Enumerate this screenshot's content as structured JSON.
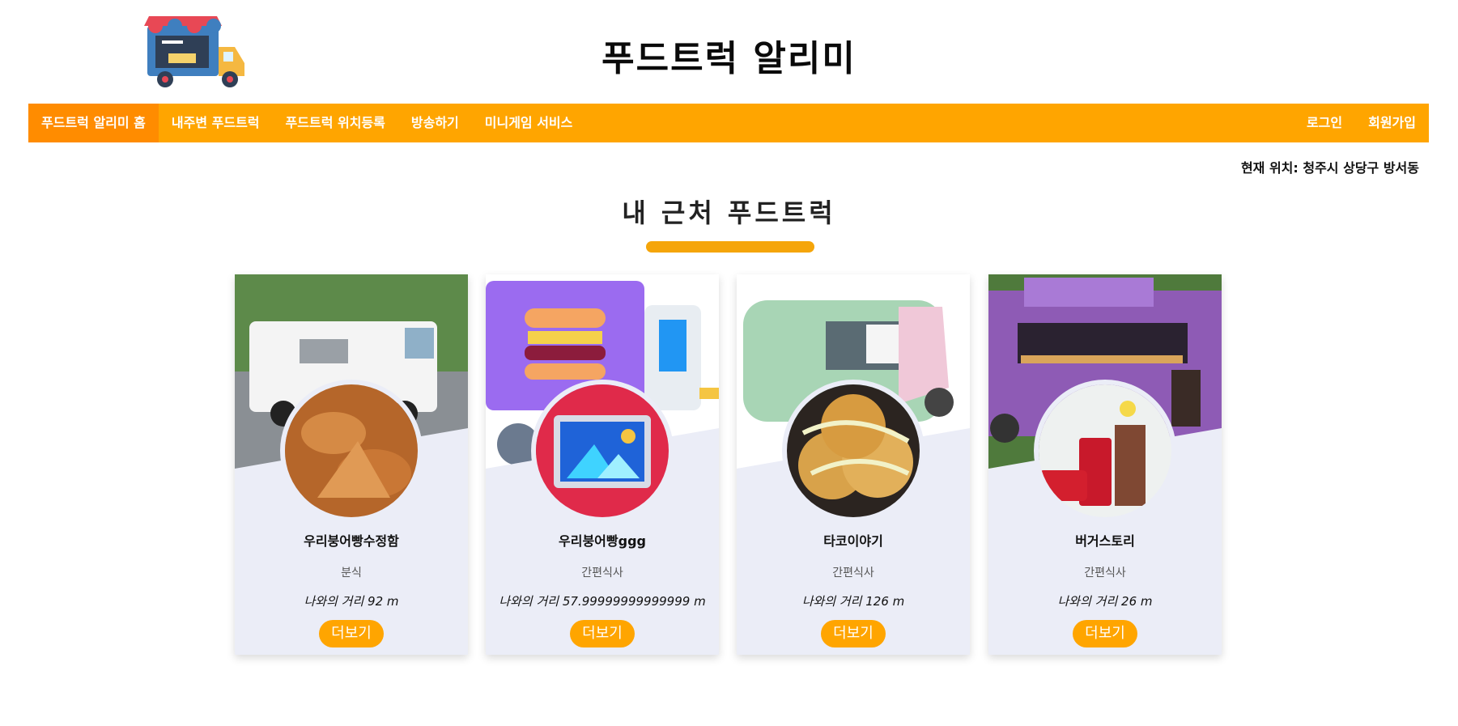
{
  "header": {
    "site_title": "푸드트럭 알리미"
  },
  "nav": {
    "left": [
      "푸드트럭 알리미 홈",
      "내주변 푸드트럭",
      "푸드트럭 위치등록",
      "방송하기",
      "미니게임 서비스"
    ],
    "right": [
      "로그인",
      "회원가입"
    ]
  },
  "location": {
    "text": "현재 위치: 청주시 상당구 방서동"
  },
  "section": {
    "title": "내 근처 푸드트럭"
  },
  "cards": [
    {
      "name": "우리붕어빵수정함",
      "category": "분식",
      "distance": "나와의 거리 92 m",
      "button": "더보기"
    },
    {
      "name": "우리붕어빵ggg",
      "category": "간편식사",
      "distance": "나와의 거리 57.99999999999999 m",
      "button": "더보기"
    },
    {
      "name": "타코이야기",
      "category": "간편식사",
      "distance": "나와의 거리 126 m",
      "button": "더보기"
    },
    {
      "name": "버거스토리",
      "category": "간편식사",
      "distance": "나와의 거리 26 m",
      "button": "더보기"
    }
  ],
  "colors": {
    "accent": "#ffa500",
    "active_nav": "#ff8c00",
    "card_bg": "#ebedf7"
  }
}
